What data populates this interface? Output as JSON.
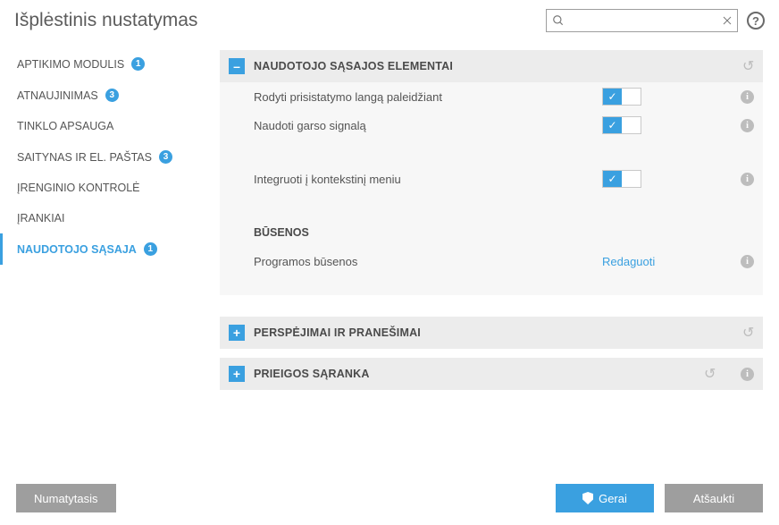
{
  "header": {
    "title": "Išplėstinis nustatymas",
    "search_placeholder": ""
  },
  "sidebar": {
    "items": [
      {
        "label": "APTIKIMO MODULIS",
        "badge": "1"
      },
      {
        "label": "ATNAUJINIMAS",
        "badge": "3"
      },
      {
        "label": "TINKLO APSAUGA",
        "badge": ""
      },
      {
        "label": "SAITYNAS IR EL. PAŠTAS",
        "badge": "3"
      },
      {
        "label": "ĮRENGINIO KONTROLĖ",
        "badge": ""
      },
      {
        "label": "ĮRANKIAI",
        "badge": ""
      },
      {
        "label": "NAUDOTOJO SĄSAJA",
        "badge": "1"
      }
    ]
  },
  "sections": {
    "ui": {
      "title": "NAUDOTOJO SĄSAJOS ELEMENTAI",
      "rows": {
        "splash": "Rodyti prisistatymo langą paleidžiant",
        "sound": "Naudoti garso signalą",
        "context": "Integruoti į kontekstinį meniu"
      },
      "statuses_title": "BŪSENOS",
      "program_statuses": "Programos būsenos",
      "edit": "Redaguoti"
    },
    "alerts": {
      "title": "PERSPĖJIMAI IR PRANEŠIMAI"
    },
    "access": {
      "title": "PRIEIGOS SĄRANKA"
    }
  },
  "footer": {
    "default": "Numatytasis",
    "ok": "Gerai",
    "cancel": "Atšaukti"
  }
}
